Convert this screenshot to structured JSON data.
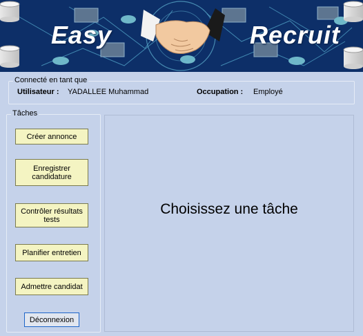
{
  "banner": {
    "word_left": "Easy",
    "word_right": "Recruit",
    "icons": [
      "database-icon",
      "handshake-icon"
    ],
    "colors": {
      "background": "#0d2f68",
      "accent": "#6fb8c9"
    }
  },
  "connection": {
    "group_title": "Connecté en tant que",
    "user_label": "Utilisateur :",
    "user_value": "YADALLEE Muhammad",
    "occupation_label": "Occupation :",
    "occupation_value": "Employé"
  },
  "tasks": {
    "group_title": "Tâches",
    "buttons": [
      {
        "label": "Créer annonce"
      },
      {
        "label": "Enregistrer candidature"
      },
      {
        "label": "Contrôler résultats tests"
      },
      {
        "label": "Planifier entretien"
      },
      {
        "label": "Admettre candidat"
      }
    ],
    "logout_label": "Déconnexion"
  },
  "main": {
    "placeholder": "Choisissez une tâche"
  },
  "colors": {
    "window_background": "#c5d2ea",
    "button_background": "#f4f4c2",
    "focus_border": "#1c64c8"
  }
}
